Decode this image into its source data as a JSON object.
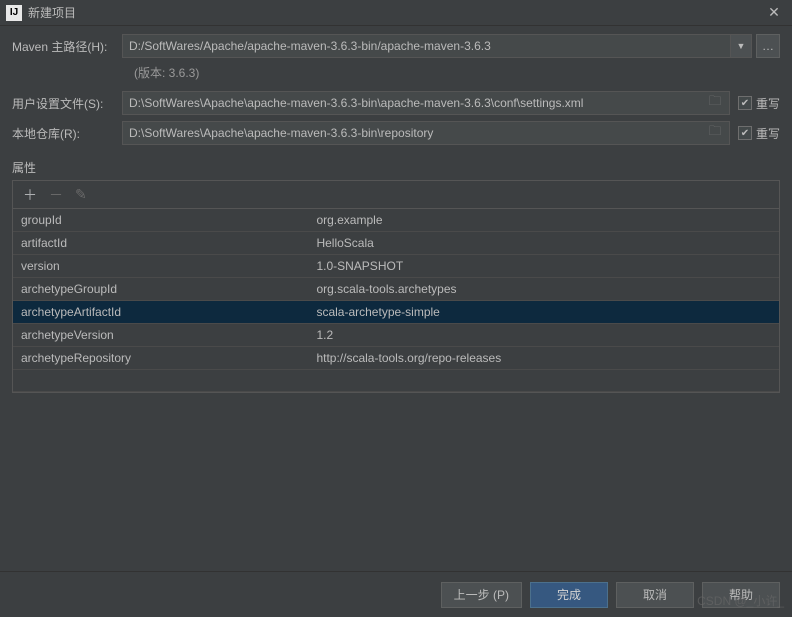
{
  "titlebar": {
    "icon_text": "IJ",
    "title": "新建项目"
  },
  "maven": {
    "home_label": "Maven 主路径(H):",
    "home_value": "D:/SoftWares/Apache/apache-maven-3.6.3-bin/apache-maven-3.6.3",
    "version_text": "(版本: 3.6.3)",
    "settings_label": "用户设置文件(S):",
    "settings_value": "D:\\SoftWares\\Apache\\apache-maven-3.6.3-bin\\apache-maven-3.6.3\\conf\\settings.xml",
    "settings_override_label": "重写",
    "repo_label": "本地仓库(R):",
    "repo_value": "D:\\SoftWares\\Apache\\apache-maven-3.6.3-bin\\repository",
    "repo_override_label": "重写"
  },
  "properties": {
    "section_label": "属性",
    "rows": [
      {
        "key": "groupId",
        "value": "org.example"
      },
      {
        "key": "artifactId",
        "value": "HelloScala"
      },
      {
        "key": "version",
        "value": "1.0-SNAPSHOT"
      },
      {
        "key": "archetypeGroupId",
        "value": "org.scala-tools.archetypes"
      },
      {
        "key": "archetypeArtifactId",
        "value": "scala-archetype-simple"
      },
      {
        "key": "archetypeVersion",
        "value": "1.2"
      },
      {
        "key": "archetypeRepository",
        "value": "http://scala-tools.org/repo-releases"
      }
    ]
  },
  "footer": {
    "prev": "上一步 (P)",
    "finish": "完成",
    "cancel": "取消",
    "help": "帮助"
  },
  "watermark": "CSDN @_小许_"
}
